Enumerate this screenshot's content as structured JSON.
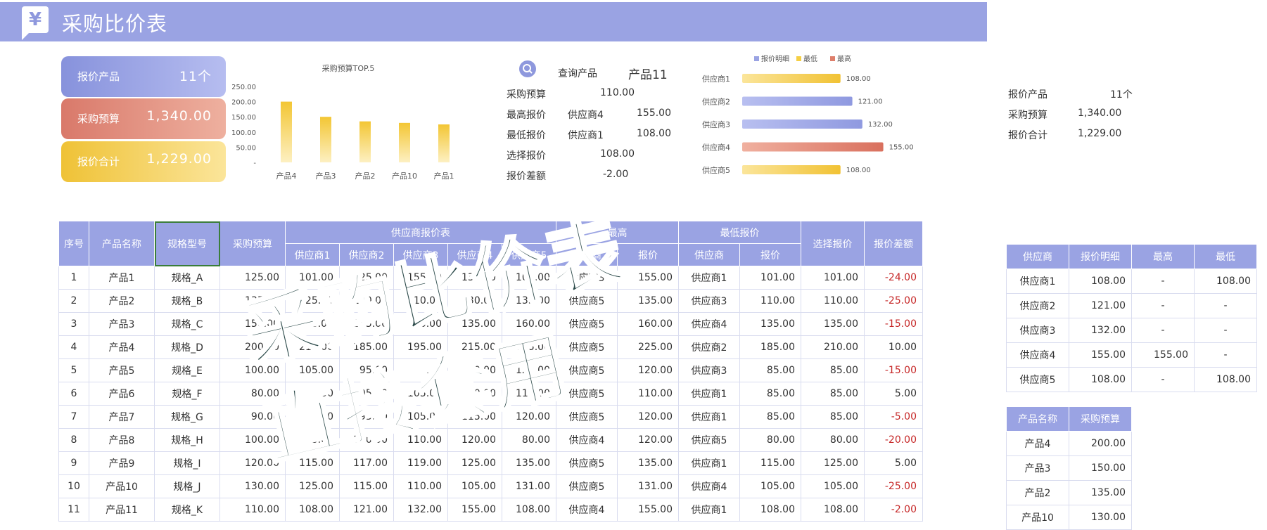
{
  "header": {
    "title": "采购比价表",
    "logo_symbol": "¥"
  },
  "kpis": [
    {
      "label": "报价产品",
      "value": "11个"
    },
    {
      "label": "采购预算",
      "value": "1,340.00"
    },
    {
      "label": "报价合计",
      "value": "1,229.00"
    }
  ],
  "chart_data": [
    {
      "type": "bar",
      "title": "采购预算TOP.5",
      "categories": [
        "产品4",
        "产品3",
        "产品2",
        "产品10",
        "产品1"
      ],
      "values": [
        200,
        150,
        135,
        130,
        125
      ],
      "y_ticks": [
        "250.00",
        "200.00",
        "150.00",
        "100.00",
        "50.00",
        "-"
      ],
      "ylim": [
        0,
        250
      ],
      "color": "#f5cf45"
    },
    {
      "type": "bar",
      "orientation": "horizontal",
      "legend": [
        "报价明细",
        "最低",
        "最高"
      ],
      "legend_colors": [
        "#9aa3e3",
        "#f5cf45",
        "#de7f6b"
      ],
      "categories": [
        "供应商1",
        "供应商2",
        "供应商3",
        "供应商4",
        "供应商5"
      ],
      "values": [
        108,
        121,
        132,
        155,
        108
      ],
      "value_labels": [
        "108.00",
        "121.00",
        "132.00",
        "155.00",
        "108.00"
      ],
      "bar_types": [
        "最低",
        "报价明细",
        "报价明细",
        "最高",
        "最低"
      ],
      "xlim": [
        0,
        170
      ]
    }
  ],
  "query": {
    "product_label": "查询产品",
    "product_value": "产品11",
    "rows": [
      {
        "label": "采购预算",
        "supplier": "",
        "value": "110.00"
      },
      {
        "label": "最高报价",
        "supplier": "供应商4",
        "value": "155.00"
      },
      {
        "label": "最低报价",
        "supplier": "供应商1",
        "value": "108.00"
      },
      {
        "label": "选择报价",
        "supplier": "",
        "value": "108.00"
      },
      {
        "label": "报价差额",
        "supplier": "",
        "value": "-2.00"
      }
    ]
  },
  "right_summary": [
    {
      "label": "报价产品",
      "value": "11个"
    },
    {
      "label": "采购预算",
      "value": "1,340.00"
    },
    {
      "label": "报价合计",
      "value": "1,229.00"
    }
  ],
  "main_table": {
    "headers": {
      "seq": "序号",
      "name": "产品名称",
      "spec": "规格型号",
      "budget": "采购预算",
      "quote_group": "供应商报价表",
      "max_group": "最高",
      "min_group": "最低报价",
      "selected": "选择报价",
      "diff": "报价差额",
      "suppliers": [
        "供应商1",
        "供应商2",
        "供应商3",
        "供应商4",
        "供应商5"
      ],
      "supplier_col": "供应商",
      "price_col": "报价"
    },
    "rows": [
      [
        "1",
        "产品1",
        "规格_A",
        "125.00",
        "101.00",
        "125.00",
        "155.00",
        "135.00",
        "106.00",
        "供应商3",
        "155.00",
        "供应商1",
        "101.00",
        "101.00",
        "-24.00"
      ],
      [
        "2",
        "产品2",
        "规格_B",
        "135.00",
        "125.00",
        "110.00",
        "110.00",
        "130.00",
        "135.00",
        "供应商5",
        "135.00",
        "供应商3",
        "110.00",
        "110.00",
        "-25.00"
      ],
      [
        "3",
        "产品3",
        "规格_C",
        "150.00",
        "155.00",
        "145.00",
        "140.00",
        "135.00",
        "160.00",
        "供应商5",
        "160.00",
        "供应商4",
        "135.00",
        "135.00",
        "-15.00"
      ],
      [
        "4",
        "产品4",
        "规格_D",
        "200.00",
        "210.00",
        "185.00",
        "195.00",
        "215.00",
        "225.00",
        "供应商5",
        "225.00",
        "供应商2",
        "185.00",
        "210.00",
        "10.00"
      ],
      [
        "5",
        "产品5",
        "规格_E",
        "100.00",
        "105.00",
        "95.00",
        "85.00",
        "110.00",
        "120.00",
        "供应商5",
        "120.00",
        "供应商3",
        "85.00",
        "85.00",
        "-15.00"
      ],
      [
        "6",
        "产品6",
        "规格_F",
        "80.00",
        "85.00",
        "95.00",
        "105.00",
        "100.00",
        "110.00",
        "供应商5",
        "110.00",
        "供应商1",
        "85.00",
        "85.00",
        "5.00"
      ],
      [
        "7",
        "产品7",
        "规格_G",
        "90.00",
        "85.00",
        "95.00",
        "105.00",
        "115.00",
        "120.00",
        "供应商5",
        "120.00",
        "供应商1",
        "85.00",
        "85.00",
        "-5.00"
      ],
      [
        "8",
        "产品8",
        "规格_H",
        "100.00",
        "95.00",
        "100.00",
        "110.00",
        "120.00",
        "80.00",
        "供应商4",
        "120.00",
        "供应商5",
        "80.00",
        "80.00",
        "-20.00"
      ],
      [
        "9",
        "产品9",
        "规格_I",
        "120.00",
        "115.00",
        "117.00",
        "119.00",
        "125.00",
        "135.00",
        "供应商5",
        "135.00",
        "供应商1",
        "115.00",
        "125.00",
        "5.00"
      ],
      [
        "10",
        "产品10",
        "规格_J",
        "130.00",
        "125.00",
        "115.00",
        "110.00",
        "105.00",
        "131.00",
        "供应商5",
        "131.00",
        "供应商4",
        "105.00",
        "105.00",
        "-25.00"
      ],
      [
        "11",
        "产品11",
        "规格_K",
        "110.00",
        "108.00",
        "121.00",
        "132.00",
        "155.00",
        "108.00",
        "供应商4",
        "155.00",
        "供应商1",
        "108.00",
        "108.00",
        "-2.00"
      ]
    ]
  },
  "supplier_table": {
    "headers": [
      "供应商",
      "报价明细",
      "最高",
      "最低"
    ],
    "rows": [
      [
        "供应商1",
        "108.00",
        "-",
        "108.00"
      ],
      [
        "供应商2",
        "121.00",
        "-",
        "-"
      ],
      [
        "供应商3",
        "132.00",
        "-",
        "-"
      ],
      [
        "供应商4",
        "155.00",
        "155.00",
        "-"
      ],
      [
        "供应商5",
        "108.00",
        "-",
        "108.00"
      ]
    ]
  },
  "budget_table": {
    "headers": [
      "产品名称",
      "采购预算"
    ],
    "rows": [
      [
        "产品4",
        "200.00"
      ],
      [
        "产品3",
        "150.00"
      ],
      [
        "产品2",
        "135.00"
      ],
      [
        "产品10",
        "130.00"
      ]
    ]
  },
  "watermark": {
    "line1": "采购比价表",
    "line2": "直接套用"
  }
}
